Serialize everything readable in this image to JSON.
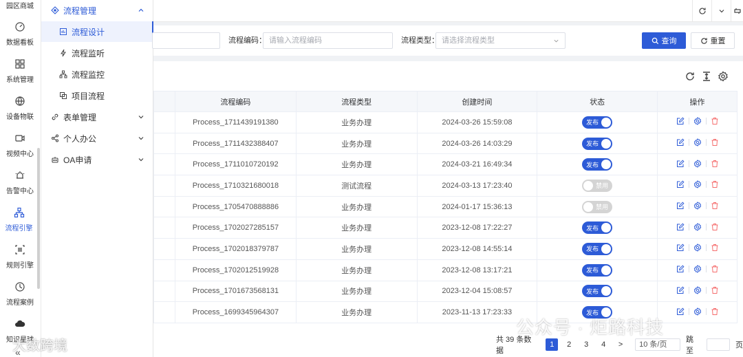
{
  "rail": {
    "items": [
      {
        "label": "园区商城",
        "icon": "store-icon"
      },
      {
        "label": "数据看板",
        "icon": "dashboard-icon"
      },
      {
        "label": "系统管理",
        "icon": "grid-icon"
      },
      {
        "label": "设备物联",
        "icon": "globe-icon"
      },
      {
        "label": "视频中心",
        "icon": "video-icon"
      },
      {
        "label": "告警中心",
        "icon": "alarm-icon"
      },
      {
        "label": "流程引擎",
        "icon": "flow-icon"
      },
      {
        "label": "规则引擎",
        "icon": "rule-icon"
      },
      {
        "label": "流程案例",
        "icon": "clock-icon"
      },
      {
        "label": "知识星球",
        "icon": "cloud-icon"
      }
    ],
    "active": "流程引擎",
    "collapse_glyph": "«"
  },
  "submenu": {
    "group_process": "流程管理",
    "items": [
      "流程设计",
      "流程监听",
      "流程监控",
      "项目流程"
    ],
    "active_item": "流程设计",
    "group_form": "表单管理",
    "group_office": "个人办公",
    "group_oa": "OA申请"
  },
  "search": {
    "code_label": "流程编码：",
    "code_placeholder": "请输入流程编码",
    "type_label": "流程类型：",
    "type_placeholder": "请选择流程类型",
    "query_label": "查询",
    "reset_label": "重置"
  },
  "table": {
    "headers": {
      "code": "流程编码",
      "type": "流程类型",
      "created": "创建时间",
      "status": "状态",
      "ops": "操作"
    },
    "status_on": "发布",
    "status_off": "禁用",
    "rows": [
      {
        "code": "Process_1711439191380",
        "type": "业务办理",
        "created": "2024-03-26 15:59:08",
        "published": true
      },
      {
        "code": "Process_1711432388407",
        "type": "业务办理",
        "created": "2024-03-26 14:03:29",
        "published": true
      },
      {
        "code": "Process_1711010720192",
        "type": "业务办理",
        "created": "2024-03-21 16:49:34",
        "published": true
      },
      {
        "code": "Process_1710321680018",
        "type": "测试流程",
        "created": "2024-03-13 17:23:40",
        "published": false
      },
      {
        "code": "Process_1705470888886",
        "type": "业务办理",
        "created": "2024-01-17 15:36:13",
        "published": false
      },
      {
        "code": "Process_1702027285157",
        "type": "业务办理",
        "created": "2023-12-08 17:22:27",
        "published": true
      },
      {
        "code": "Process_1702018379787",
        "type": "业务办理",
        "created": "2023-12-08 14:55:14",
        "published": true
      },
      {
        "code": "Process_1702012519928",
        "type": "业务办理",
        "created": "2023-12-08 13:17:21",
        "published": true
      },
      {
        "code": "Process_1701673568131",
        "type": "业务办理",
        "created": "2023-12-04 15:08:57",
        "published": true
      },
      {
        "code": "Process_1699345964307",
        "type": "业务办理",
        "created": "2023-11-13 17:23:33",
        "published": true
      }
    ]
  },
  "pager": {
    "total": "共 39 条数据",
    "pages": [
      "1",
      "2",
      "3",
      "4"
    ],
    "current": "1",
    "next": ">",
    "page_size": "10 条/页",
    "jump_label": "跳至",
    "page_suffix": "页"
  },
  "watermark": {
    "right": "公众号 · 炬路科技",
    "left": "大数跨境"
  },
  "colors": {
    "primary": "#2d5bd7",
    "danger": "#f56c6c",
    "muted": "#d4d4d4"
  }
}
